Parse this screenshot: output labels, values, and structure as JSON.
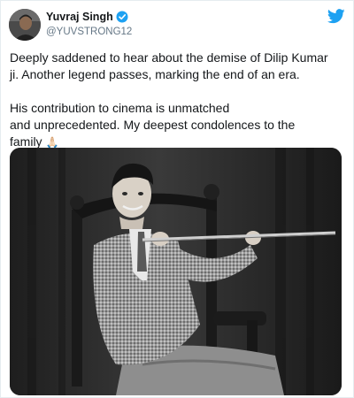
{
  "author": {
    "display_name": "Yuvraj Singh",
    "handle": "@YUVSTRONG12",
    "verified_icon": "verified-badge-icon",
    "avatar_icon": "profile-avatar"
  },
  "platform_icon": "twitter-bird-icon",
  "colors": {
    "brand": "#1da1f2",
    "text": "#14171a",
    "secondary": "#657786"
  },
  "tweet": {
    "line1": "Deeply saddened to hear about the demise of Dilip Kumar",
    "line2": "ji. Another legend passes, marking the end of an era.",
    "line3": "His contribution to cinema is unmatched",
    "line4": "and unprecedented.  My deepest condolences to the",
    "line5": "family",
    "emoji": "🙏🏻"
  },
  "media": {
    "type": "black-and-white photograph",
    "icon": "photo-image"
  }
}
